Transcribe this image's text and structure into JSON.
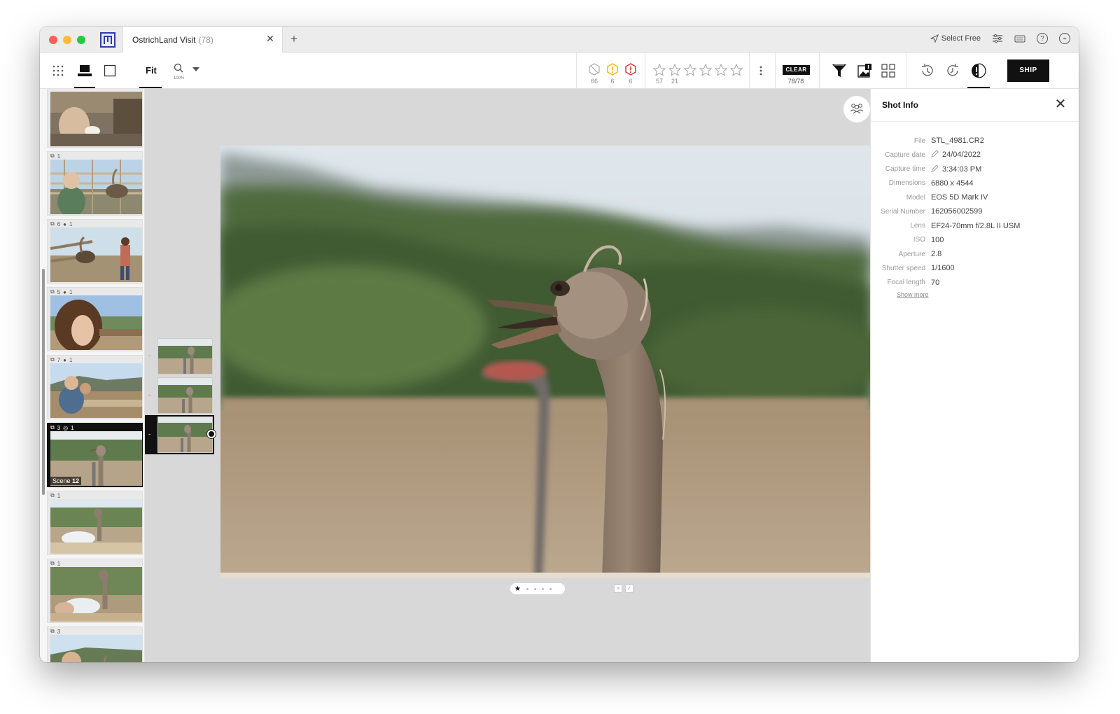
{
  "window": {
    "tab_title": "OstrichLand Visit",
    "tab_count": "(78)",
    "select_label": "Select Free"
  },
  "toolbar": {
    "fit_label": "Fit",
    "zoom_percent": "100%",
    "flags": [
      {
        "name": "rejected",
        "count": "66"
      },
      {
        "name": "warning",
        "count": "6"
      },
      {
        "name": "error",
        "count": "6"
      }
    ],
    "stars": [
      {
        "count": "57"
      },
      {
        "count": "21"
      },
      {
        "count": ""
      },
      {
        "count": ""
      },
      {
        "count": ""
      },
      {
        "count": ""
      }
    ],
    "clear_label": "CLEAR",
    "clear_count": "78/78",
    "ship_label": "SHIP"
  },
  "filmstrip": {
    "thumbs": [
      {
        "badge_a": "",
        "badge_b": ""
      },
      {
        "badge_a": "1",
        "badge_b": ""
      },
      {
        "badge_a": "6",
        "badge_b": "1"
      },
      {
        "badge_a": "5",
        "badge_b": "1"
      },
      {
        "badge_a": "7",
        "badge_b": "1"
      },
      {
        "badge_a": "3",
        "badge_b": "1",
        "scene_prefix": "Scene",
        "scene_number": "12"
      },
      {
        "badge_a": "1",
        "badge_b": ""
      },
      {
        "badge_a": "1",
        "badge_b": ""
      },
      {
        "badge_a": "3",
        "badge_b": ""
      }
    ]
  },
  "stack": {
    "dash": "-"
  },
  "viewer": {
    "faces_count": "0"
  },
  "shot_info": {
    "title": "Shot Info",
    "rows": [
      {
        "key": "File",
        "value": "STL_4981.CR2"
      },
      {
        "key": "Capture date",
        "value": "24/04/2022"
      },
      {
        "key": "Capture time",
        "value": "3:34:03 PM"
      },
      {
        "key": "Dimensions",
        "value": "6880 x 4544"
      },
      {
        "key": "Model",
        "value": "EOS 5D Mark IV"
      },
      {
        "key": "Serial Number",
        "value": "162056002599"
      },
      {
        "key": "Lens",
        "value": "EF24-70mm f/2.8L II USM"
      },
      {
        "key": "ISO",
        "value": "100"
      },
      {
        "key": "Aperture",
        "value": "2.8"
      },
      {
        "key": "Shutter speed",
        "value": "1/1600"
      },
      {
        "key": "Focal length",
        "value": "70"
      }
    ],
    "show_more": "Show more"
  },
  "colors": {
    "accent": "#111111",
    "warning": "#f0b400",
    "error": "#d0312d"
  }
}
